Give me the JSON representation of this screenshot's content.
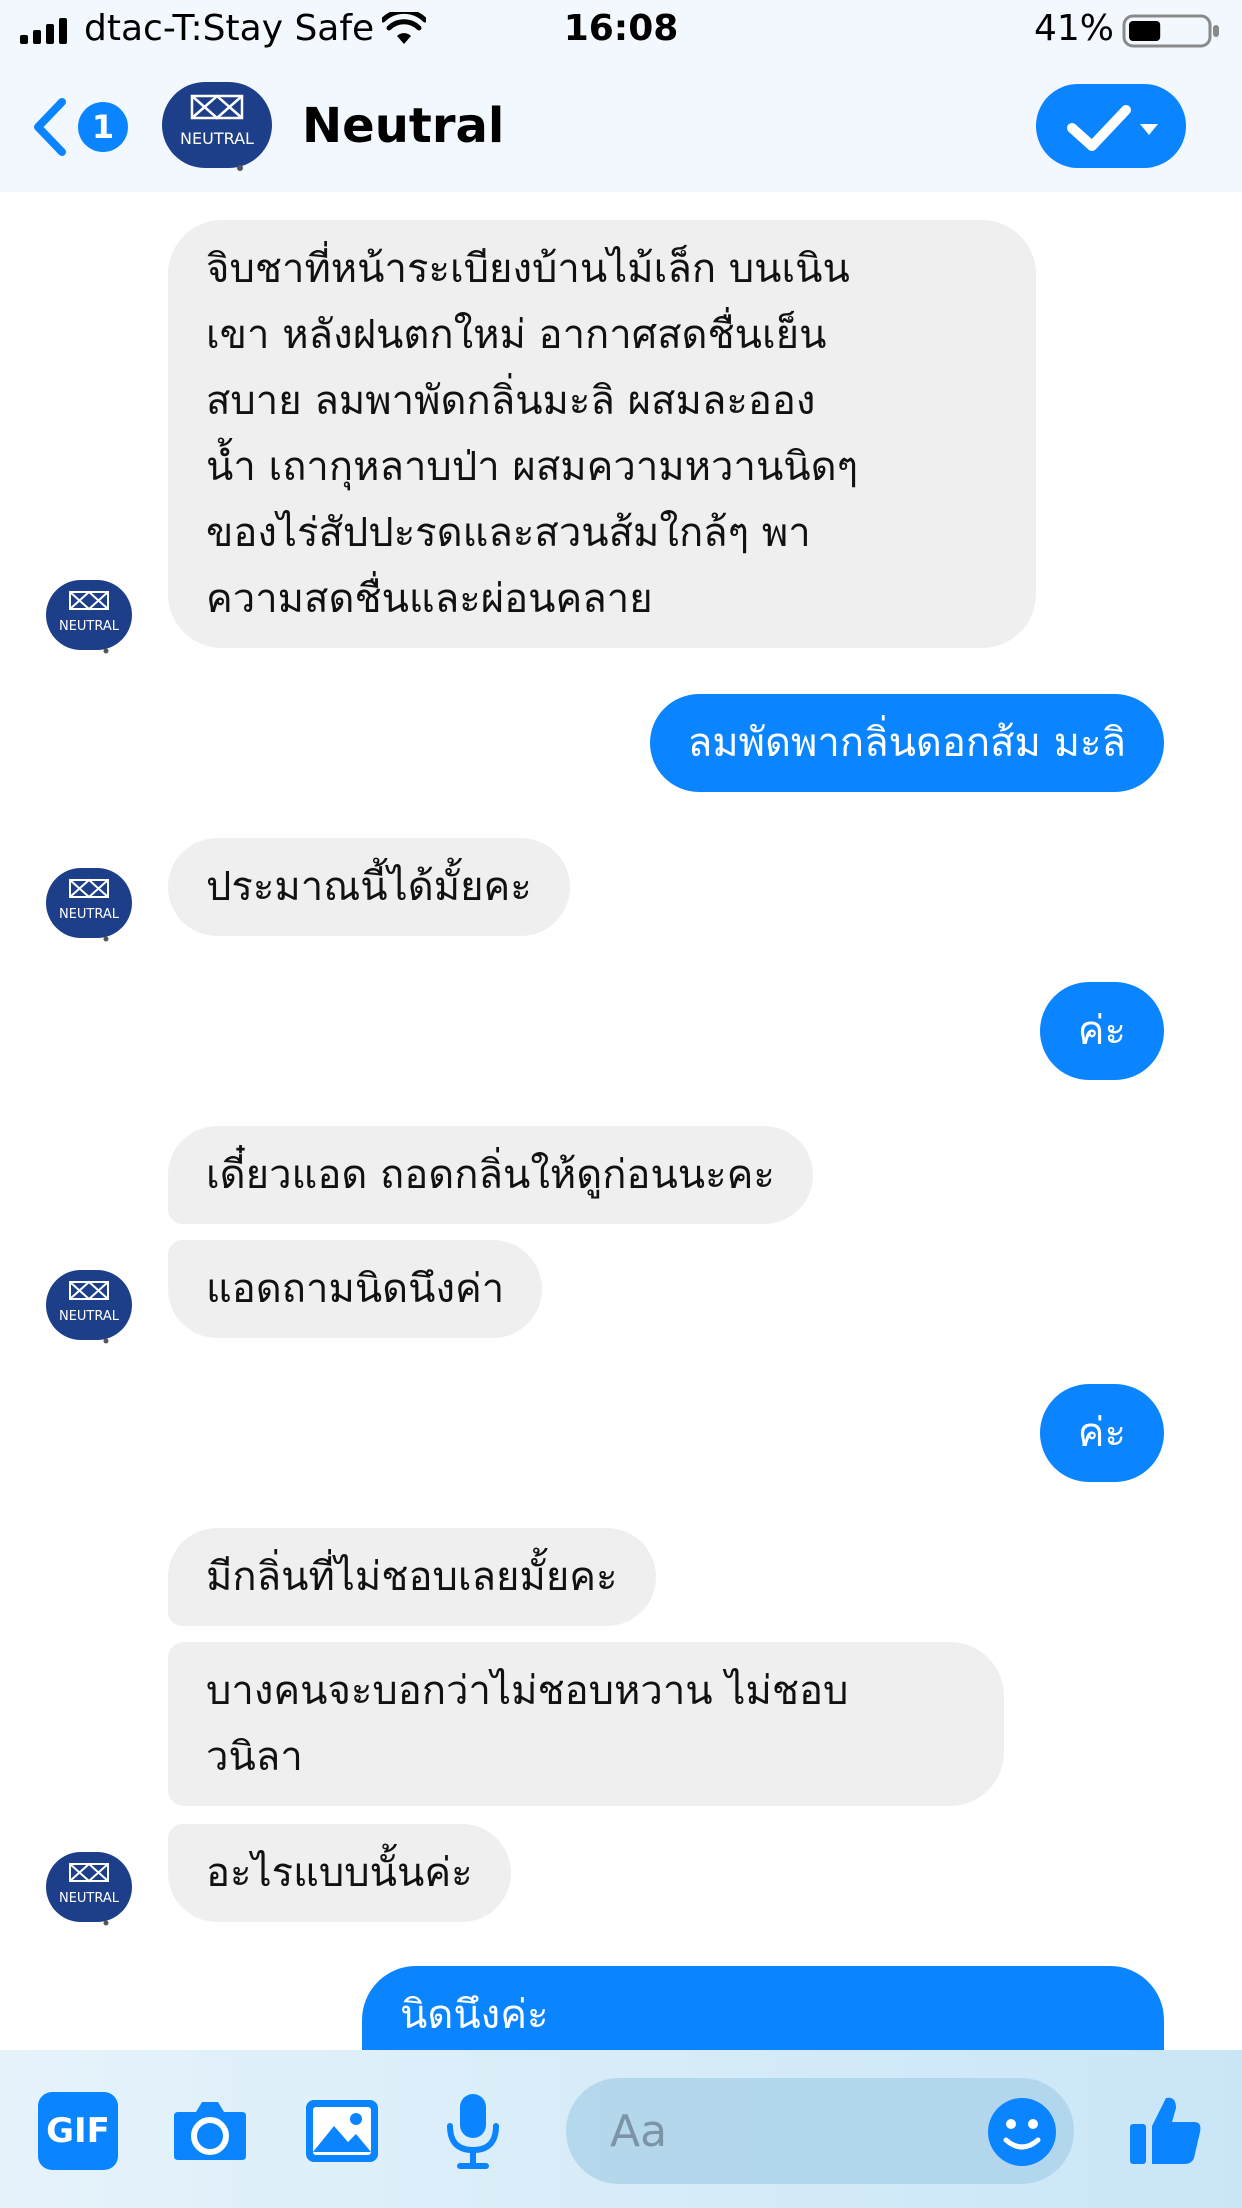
{
  "status_bar": {
    "carrier": "dtac-T:Stay Safe",
    "time": "16:08",
    "battery_percent": "41%",
    "battery_level": 0.41
  },
  "header": {
    "back_count": "1",
    "contact_name": "Neutral",
    "avatar_text": "NEUTRAL"
  },
  "messages": [
    {
      "from": "them",
      "text": "จิบชาที่หน้าระเบียงบ้านไม้เล็ก บนเนิน\nเขา หลังฝนตกใหม่ อากาศสดชื่นเย็น\nสบาย ลมพาพัดกลิ่นมะลิ ผสมละออง\nน้ำ เถากุหลาบป่า ผสมความหวานนิดๆ\nของไร่สัปปะรดและสวนส้มใกล้ๆ พา\nความสดชื่นและผ่อนคลาย"
    },
    {
      "from": "me",
      "text": "ลมพัดพากลิ่นดอกส้ม มะลิ"
    },
    {
      "from": "them",
      "text": "ประมาณนี้ได้มั้ยคะ"
    },
    {
      "from": "me",
      "text": "ค่ะ"
    },
    {
      "from": "them",
      "text": "เดี๋ยวแอด ถอดกลิ่นให้ดูก่อนนะคะ"
    },
    {
      "from": "them",
      "text": "แอดถามนิดนึงค่า"
    },
    {
      "from": "me",
      "text": "ค่ะ"
    },
    {
      "from": "them",
      "text": "มีกลิ่นที่ไม่ชอบเลยมั้ยคะ"
    },
    {
      "from": "them",
      "text": "บางคนจะบอกว่าไม่ชอบหวาน ไม่ชอบ\nวนิลา"
    },
    {
      "from": "them",
      "text": "อะไรแบบนั้นค่ะ"
    },
    {
      "from": "me",
      "text": "นิดนึงค่ะ"
    }
  ],
  "composer": {
    "gif_label": "GIF",
    "placeholder": "Aa"
  },
  "colors": {
    "accent": "#0a84ff",
    "incoming_bubble": "#efefef",
    "avatar_bg": "#1d3f8a"
  }
}
